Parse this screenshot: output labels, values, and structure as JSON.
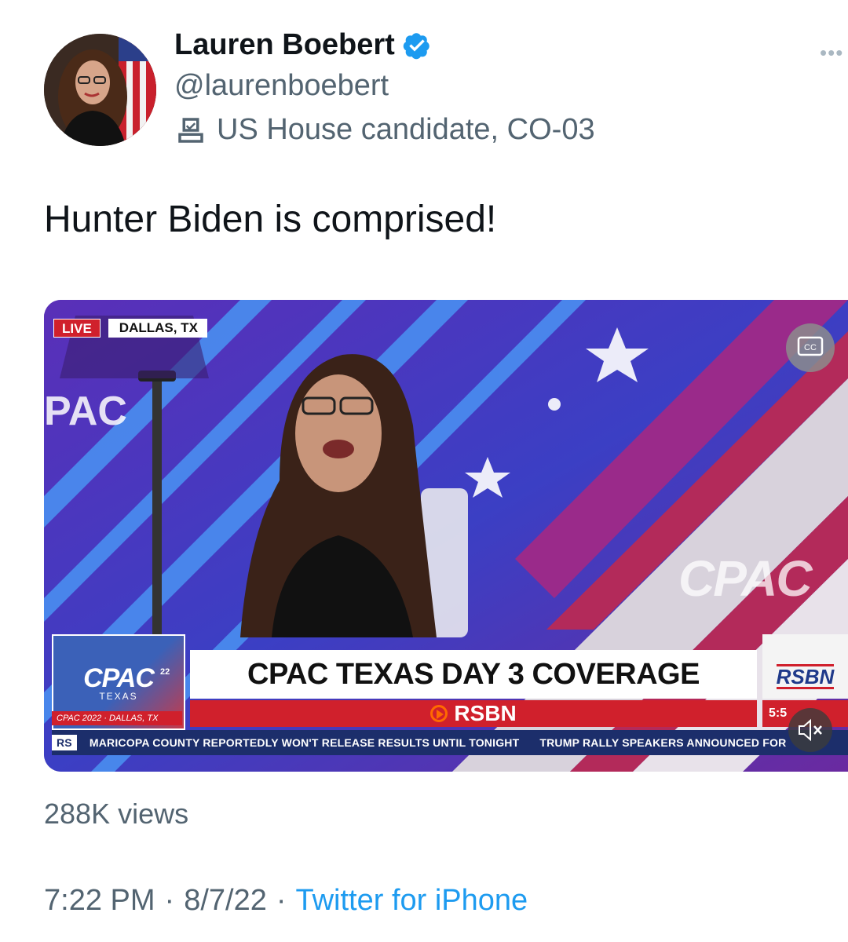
{
  "author": {
    "name": "Lauren Boebert",
    "handle": "@laurenboebert",
    "label": "US House candidate, CO-03",
    "verified": true
  },
  "tweet": {
    "text": "Hunter Biden is comprised!"
  },
  "video": {
    "live_badge": "LIVE",
    "location_badge": "DALLAS, TX",
    "bg_sign_text": "PAC",
    "cpac_watermark": "CPAC",
    "cpac_logo_main": "CPAC",
    "cpac_logo_year": "22",
    "cpac_logo_sub": "TEXAS",
    "cpac_logo_caption": "CPAC 2022 · DALLAS, TX",
    "headline": "CPAC TEXAS DAY 3 COVERAGE",
    "subline": "RSBN",
    "rsbn_logo": "RSBN",
    "rsbn_time": "5:5",
    "ticker_tag": "RS",
    "ticker_item_1": "MARICOPA COUNTY REPORTEDLY WON'T RELEASE RESULTS UNTIL TONIGHT",
    "ticker_item_2": "TRUMP RALLY SPEAKERS ANNOUNCED FOR",
    "cc_label": "CC"
  },
  "stats": {
    "views": "288K views"
  },
  "footer": {
    "time": "7:22 PM",
    "separator": "·",
    "date": "8/7/22",
    "source": "Twitter for iPhone"
  },
  "colors": {
    "accent": "#1d9bf0",
    "text_primary": "#0f1419",
    "text_secondary": "#536471",
    "cpac_red": "#d0202c",
    "cpac_blue": "#1c2e6b"
  }
}
